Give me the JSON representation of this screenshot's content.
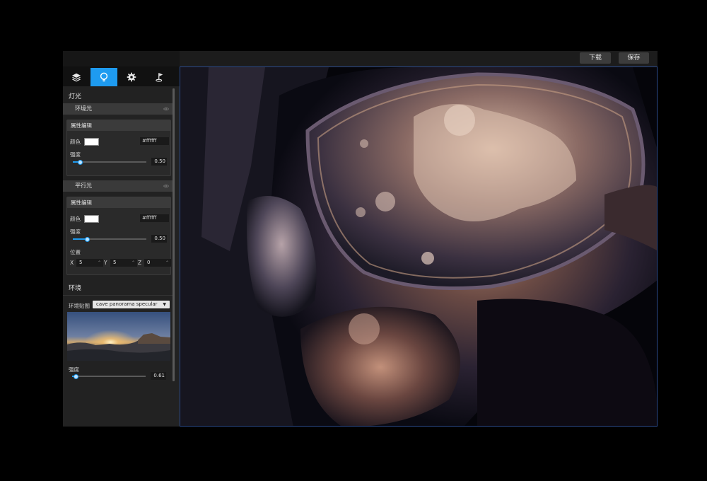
{
  "toolbar": {
    "download_label": "下载",
    "save_label": "保存"
  },
  "tabs": [
    {
      "icon": "layers-icon",
      "active": false
    },
    {
      "icon": "lightbulb-icon",
      "active": true
    },
    {
      "icon": "gear-icon",
      "active": false
    },
    {
      "icon": "flag-icon",
      "active": false
    }
  ],
  "lights": {
    "section_title": "灯光",
    "ambient": {
      "name": "环境光",
      "prop_title": "属性编辑",
      "color_label": "颜色",
      "color_value": "#ffffff",
      "intensity_label": "强度",
      "intensity_value": "0.50"
    },
    "directional": {
      "name": "平行光",
      "prop_title": "属性编辑",
      "color_label": "颜色",
      "color_value": "#ffffff",
      "intensity_label": "强度",
      "intensity_value": "0.50",
      "position_label": "位置",
      "x_label": "X",
      "x_value": "5",
      "y_label": "Y",
      "y_value": "5",
      "z_label": "Z",
      "z_value": "0"
    }
  },
  "environment": {
    "section_title": "环境",
    "map_label": "环境贴图",
    "map_selected": "cave panorama specular",
    "intensity_label": "强度",
    "intensity_value": "0.61"
  },
  "colors": {
    "accent": "#1e9bf0",
    "panel": "#222222",
    "header": "#3a3a3a"
  }
}
